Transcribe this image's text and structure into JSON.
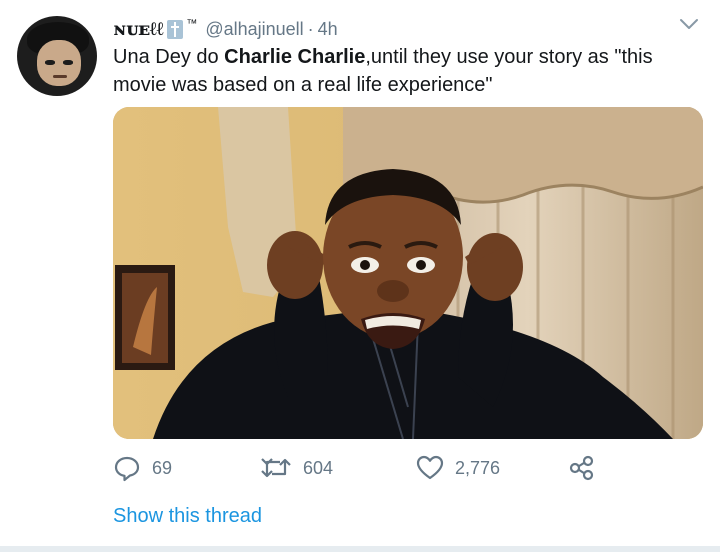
{
  "tweet": {
    "author_name": "ɴᴜᴇℓℓ",
    "name_badge": "™",
    "handle": "@alhajinuell",
    "separator": "·",
    "time": "4h",
    "text_before": "Una Dey do ",
    "text_bold": "Charlie Charlie",
    "text_after": ",until they use your story as \"this movie was based on a real life experience\"",
    "thread_link": "Show this thread"
  },
  "actions": {
    "replies": "69",
    "retweets": "604",
    "likes": "2,776"
  },
  "colors": {
    "accent": "#1b95e0",
    "secondary_text": "#657786",
    "primary_text": "#14171a",
    "divider": "#e6ecf0"
  },
  "icons": [
    "chevron-down-icon",
    "reply-icon",
    "retweet-icon",
    "like-icon",
    "share-icon",
    "cross-emoji-icon"
  ]
}
